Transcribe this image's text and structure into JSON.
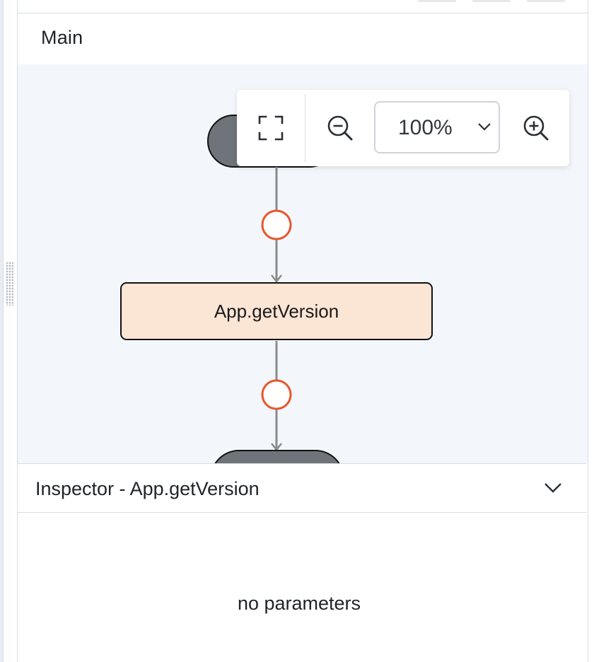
{
  "panel": {
    "title": "Main"
  },
  "flow": {
    "step_node_label": "App.getVersion",
    "colors": {
      "canvas_bg": "#f3f7fc",
      "terminal_fill": "#6f747b",
      "step_fill": "#fbe5d5",
      "connector_stroke": "#e8562c",
      "edge": "#8a8a8a"
    }
  },
  "toolbar": {
    "fit_icon": "fit-to-screen-icon",
    "zoom_out_icon": "zoom-out-icon",
    "zoom_level": "100%",
    "zoom_in_icon": "zoom-in-icon"
  },
  "inspector": {
    "title": "Inspector - App.getVersion",
    "empty_message": "no parameters",
    "collapse_icon": "chevron-down-icon"
  }
}
